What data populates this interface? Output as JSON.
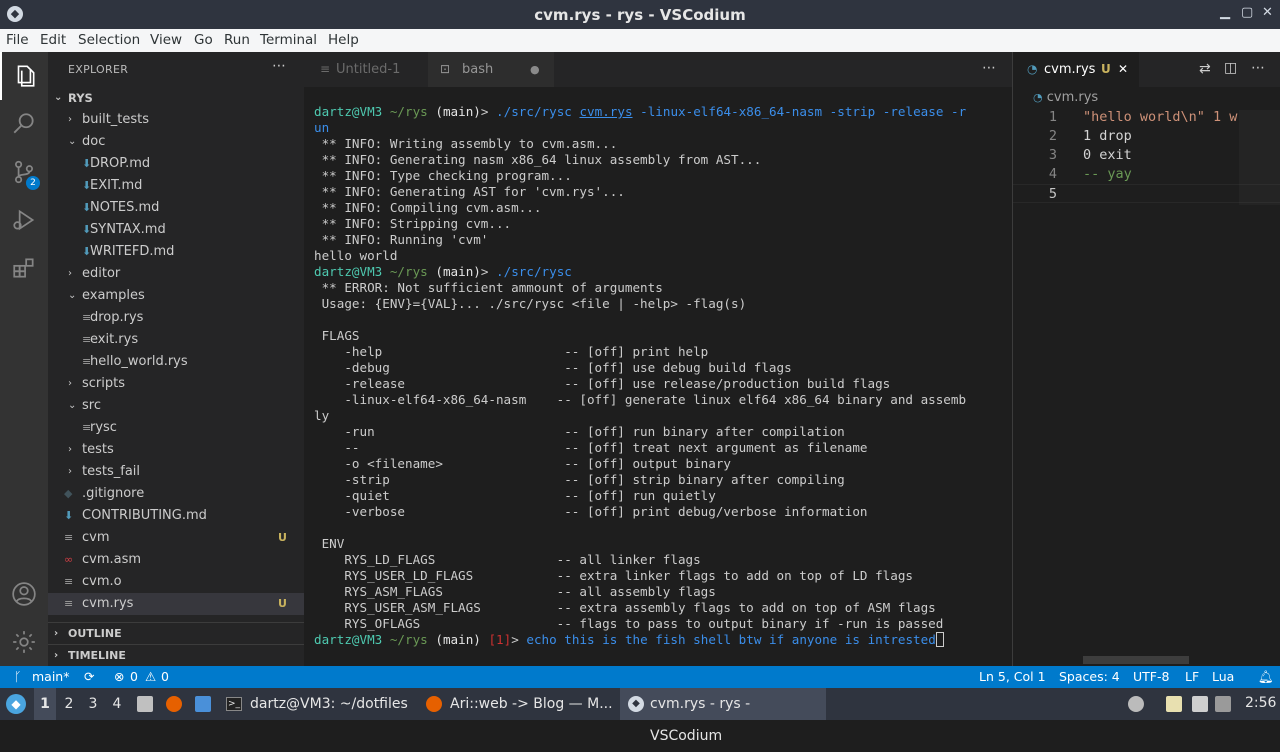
{
  "window": {
    "title": "cvm.rys - rys - VSCodium"
  },
  "menu": [
    "File",
    "Edit",
    "Selection",
    "View",
    "Go",
    "Run",
    "Terminal",
    "Help"
  ],
  "sidebar": {
    "header": "EXPLORER",
    "root": "RYS",
    "items": [
      {
        "label": "built_tests",
        "type": "folder",
        "depth": 1,
        "open": false
      },
      {
        "label": "doc",
        "type": "folder",
        "depth": 1,
        "open": true
      },
      {
        "label": "DROP.md",
        "type": "md",
        "depth": 2
      },
      {
        "label": "EXIT.md",
        "type": "md",
        "depth": 2
      },
      {
        "label": "NOTES.md",
        "type": "md",
        "depth": 2
      },
      {
        "label": "SYNTAX.md",
        "type": "md",
        "depth": 2
      },
      {
        "label": "WRITEFD.md",
        "type": "md",
        "depth": 2
      },
      {
        "label": "editor",
        "type": "folder",
        "depth": 1,
        "open": false
      },
      {
        "label": "examples",
        "type": "folder",
        "depth": 1,
        "open": true
      },
      {
        "label": "drop.rys",
        "type": "file",
        "depth": 2
      },
      {
        "label": "exit.rys",
        "type": "file",
        "depth": 2
      },
      {
        "label": "hello_world.rys",
        "type": "file",
        "depth": 2
      },
      {
        "label": "scripts",
        "type": "folder",
        "depth": 1,
        "open": false
      },
      {
        "label": "src",
        "type": "folder",
        "depth": 1,
        "open": true
      },
      {
        "label": "rysc",
        "type": "file",
        "depth": 2
      },
      {
        "label": "tests",
        "type": "folder",
        "depth": 1,
        "open": false
      },
      {
        "label": "tests_fail",
        "type": "folder",
        "depth": 1,
        "open": false
      },
      {
        "label": ".gitignore",
        "type": "git",
        "depth": 1
      },
      {
        "label": "CONTRIBUTING.md",
        "type": "md",
        "depth": 1
      },
      {
        "label": "cvm",
        "type": "file",
        "depth": 1,
        "status": "U"
      },
      {
        "label": "cvm.asm",
        "type": "asm",
        "depth": 1
      },
      {
        "label": "cvm.o",
        "type": "file",
        "depth": 1
      },
      {
        "label": "cvm.rys",
        "type": "file",
        "depth": 1,
        "status": "U",
        "selected": true
      }
    ],
    "outline": "OUTLINE",
    "timeline": "TIMELINE"
  },
  "editor": {
    "tabs": [
      {
        "label": "Untitled-1"
      },
      {
        "label": "bash"
      }
    ]
  },
  "terminal": {
    "prompt_user": "dartz@VM3",
    "prompt_dir": "~/rys",
    "prompt_branch": "(main)",
    "cmd1": "./src/rysc",
    "cmd1_file": "cvm.rys",
    "cmd1_flags": "-linux-elf64-x86_64-nasm -strip -release -r",
    "cmd1_wrap": "un",
    "info": [
      " ** INFO: Writing assembly to cvm.asm...",
      " ** INFO: Generating nasm x86_64 linux assembly from AST...",
      " ** INFO: Type checking program...",
      " ** INFO: Generating AST for 'cvm.rys'...",
      " ** INFO: Compiling cvm.asm...",
      " ** INFO: Stripping cvm...",
      " ** INFO: Running 'cvm'"
    ],
    "hello": "hello world",
    "cmd2": "./src/rysc",
    "out": [
      " ** ERROR: Not sufficient ammount of arguments",
      " Usage: {ENV}={VAL}... ./src/rysc <file | -help> -flag(s)",
      "",
      " FLAGS",
      "    -help                        -- [off] print help",
      "    -debug                       -- [off] use debug build flags",
      "    -release                     -- [off] use release/production build flags",
      "    -linux-elf64-x86_64-nasm    -- [off] generate linux elf64 x86_64 binary and assemb",
      "ly",
      "    -run                         -- [off] run binary after compilation",
      "    --                           -- [off] treat next argument as filename",
      "    -o <filename>                -- [off] output binary",
      "    -strip                       -- [off] strip binary after compiling",
      "    -quiet                       -- [off] run quietly",
      "    -verbose                     -- [off] print debug/verbose information",
      "",
      " ENV",
      "    RYS_LD_FLAGS                -- all linker flags",
      "    RYS_USER_LD_FLAGS           -- extra linker flags to add on top of LD flags",
      "    RYS_ASM_FLAGS               -- all assembly flags",
      "    RYS_USER_ASM_FLAGS          -- extra assembly flags to add on top of ASM flags",
      "    RYS_OFLAGS                  -- flags to pass to output binary if -run is passed"
    ],
    "last_status": "[1]",
    "cmd3": "echo this is the fish shell btw if anyone is intrested"
  },
  "right_editor": {
    "tab": "cvm.rys",
    "tab_status": "U",
    "breadcrumb": "cvm.rys",
    "lines": [
      {
        "n": "1",
        "t": "\"hello world\\n\" 1 w"
      },
      {
        "n": "2",
        "t": "1 drop"
      },
      {
        "n": "3",
        "t": "0 exit"
      },
      {
        "n": "4",
        "t": "-- yay"
      },
      {
        "n": "5",
        "t": ""
      }
    ]
  },
  "status": {
    "branch": "main*",
    "errors": "0",
    "warnings": "0",
    "position": "Ln 5, Col 1",
    "spaces": "Spaces: 4",
    "encoding": "UTF-8",
    "eol": "LF",
    "lang": "Lua"
  },
  "taskbar": {
    "workspaces": [
      "1",
      "2",
      "3",
      "4"
    ],
    "apps": [
      {
        "label": "dartz@VM3: ~/dotfiles"
      },
      {
        "label": "Ari::web -> Blog — M..."
      },
      {
        "label": "cvm.rys - rys - VSCodium"
      }
    ],
    "clock": "2:56"
  },
  "colors": {
    "accent": "#007acc",
    "status_bar": "#007acc",
    "untracked": "#c9b35e"
  }
}
